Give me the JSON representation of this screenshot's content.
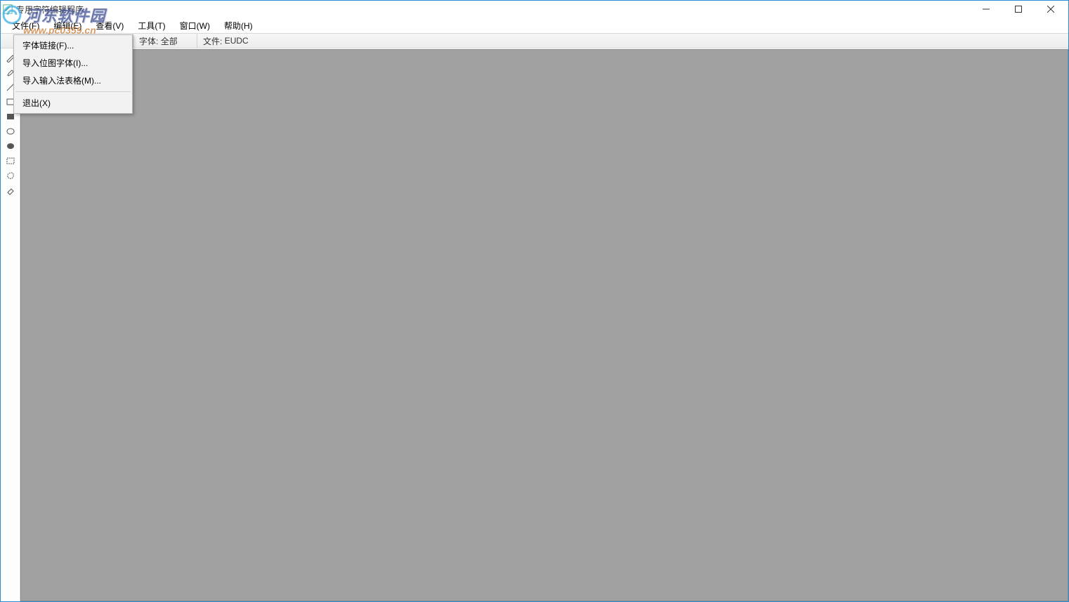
{
  "title": "专用字符编辑程序",
  "menu": {
    "file": "文件(F)",
    "edit": "编辑(E)",
    "view": "查看(V)",
    "tool": "工具(T)",
    "window": "窗口(W)",
    "help": "帮助(H)"
  },
  "file_menu": {
    "font_link": "字体链接(F)...",
    "import_bitmap": "导入位图字体(I)...",
    "import_ime": "导入输入法表格(M)...",
    "exit": "退出(X)"
  },
  "infobar": {
    "font_label": "字体:",
    "font_value": "全部",
    "file_label": "文件:",
    "file_value": "EUDC"
  },
  "tools": {
    "pencil": "pencil-icon",
    "brush": "brush-icon",
    "line": "line-icon",
    "rect_outline": "rectangle-outline-icon",
    "rect_filled": "rectangle-filled-icon",
    "ellipse_outline": "ellipse-outline-icon",
    "ellipse_filled": "ellipse-filled-icon",
    "select_rect": "select-rectangle-icon",
    "select_free": "select-freeform-icon",
    "eraser": "eraser-icon"
  },
  "watermark": {
    "main": "河东软件园",
    "url": "www.pc0359.cn"
  }
}
